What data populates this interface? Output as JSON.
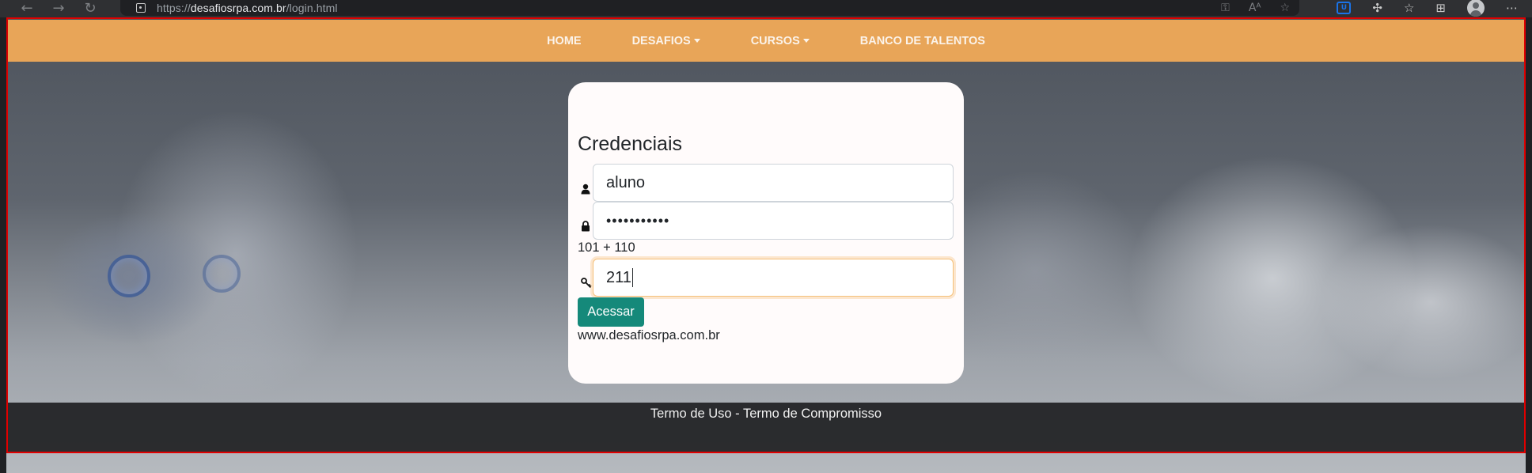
{
  "browser": {
    "url_prefix": "https://",
    "url_host": "desafiosrpa.com.br",
    "url_path": "/login.html",
    "extension_badge": "U"
  },
  "navbar": {
    "items": [
      {
        "label": "HOME",
        "dropdown": false
      },
      {
        "label": "DESAFIOS",
        "dropdown": true
      },
      {
        "label": "CURSOS",
        "dropdown": true
      },
      {
        "label": "BANCO DE TALENTOS",
        "dropdown": false
      }
    ]
  },
  "login": {
    "title": "Credenciais",
    "username_value": "aluno",
    "password_value": "•••••••••••",
    "captcha_question": "101 + 110",
    "captcha_value": "211",
    "submit_label": "Acessar",
    "site_text": "www.desafiosrpa.com.br"
  },
  "footer": {
    "text": "Termo de Uso - Termo de Compromisso"
  },
  "colors": {
    "navbar_bg": "#e8a558",
    "button_bg": "#15897a",
    "card_bg": "#fffbfb",
    "footer_bg": "#202123",
    "frame": "#e00000"
  }
}
